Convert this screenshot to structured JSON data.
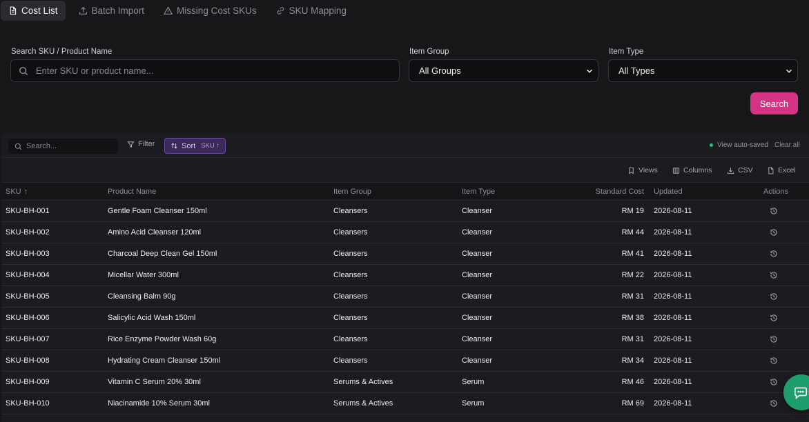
{
  "tabs": [
    {
      "label": "Cost List",
      "icon": "document-icon",
      "active": true
    },
    {
      "label": "Batch Import",
      "icon": "upload-icon",
      "active": false
    },
    {
      "label": "Missing Cost SKUs",
      "icon": "warning-icon",
      "active": false
    },
    {
      "label": "SKU Mapping",
      "icon": "link-icon",
      "active": false
    }
  ],
  "filters": {
    "search_label": "Search SKU / Product Name",
    "search_placeholder": "Enter SKU or product name...",
    "group_label": "Item Group",
    "group_value": "All Groups",
    "type_label": "Item Type",
    "type_value": "All Types",
    "search_button": "Search"
  },
  "toolbar": {
    "search_placeholder": "Search...",
    "filter_label": "Filter",
    "sort_label": "Sort",
    "sort_field": "SKU ↑",
    "autosave_text": "View auto-saved",
    "clear_all": "Clear all",
    "views": "Views",
    "columns": "Columns",
    "csv": "CSV",
    "excel": "Excel"
  },
  "table": {
    "headers": {
      "sku": "SKU",
      "sku_sort": "↑",
      "name": "Product Name",
      "group": "Item Group",
      "type": "Item Type",
      "cost": "Standard Cost",
      "updated": "Updated",
      "actions": "Actions"
    },
    "rows": [
      {
        "sku": "SKU-BH-001",
        "name": "Gentle Foam Cleanser 150ml",
        "group": "Cleansers",
        "type": "Cleanser",
        "cost": "RM 19",
        "updated": "2026-08-11"
      },
      {
        "sku": "SKU-BH-002",
        "name": "Amino Acid Cleanser 120ml",
        "group": "Cleansers",
        "type": "Cleanser",
        "cost": "RM 44",
        "updated": "2026-08-11"
      },
      {
        "sku": "SKU-BH-003",
        "name": "Charcoal Deep Clean Gel 150ml",
        "group": "Cleansers",
        "type": "Cleanser",
        "cost": "RM 41",
        "updated": "2026-08-11"
      },
      {
        "sku": "SKU-BH-004",
        "name": "Micellar Water 300ml",
        "group": "Cleansers",
        "type": "Cleanser",
        "cost": "RM 22",
        "updated": "2026-08-11"
      },
      {
        "sku": "SKU-BH-005",
        "name": "Cleansing Balm 90g",
        "group": "Cleansers",
        "type": "Cleanser",
        "cost": "RM 31",
        "updated": "2026-08-11"
      },
      {
        "sku": "SKU-BH-006",
        "name": "Salicylic Acid Wash 150ml",
        "group": "Cleansers",
        "type": "Cleanser",
        "cost": "RM 38",
        "updated": "2026-08-11"
      },
      {
        "sku": "SKU-BH-007",
        "name": "Rice Enzyme Powder Wash 60g",
        "group": "Cleansers",
        "type": "Cleanser",
        "cost": "RM 31",
        "updated": "2026-08-11"
      },
      {
        "sku": "SKU-BH-008",
        "name": "Hydrating Cream Cleanser 150ml",
        "group": "Cleansers",
        "type": "Cleanser",
        "cost": "RM 34",
        "updated": "2026-08-11"
      },
      {
        "sku": "SKU-BH-009",
        "name": "Vitamin C Serum 20% 30ml",
        "group": "Serums & Actives",
        "type": "Serum",
        "cost": "RM 46",
        "updated": "2026-08-11"
      },
      {
        "sku": "SKU-BH-010",
        "name": "Niacinamide 10% Serum 30ml",
        "group": "Serums & Actives",
        "type": "Serum",
        "cost": "RM 69",
        "updated": "2026-08-11"
      }
    ]
  },
  "colors": {
    "accent": "#d63384",
    "sort_active": "#2ecc71",
    "chat_fab": "#1e9e6c"
  }
}
